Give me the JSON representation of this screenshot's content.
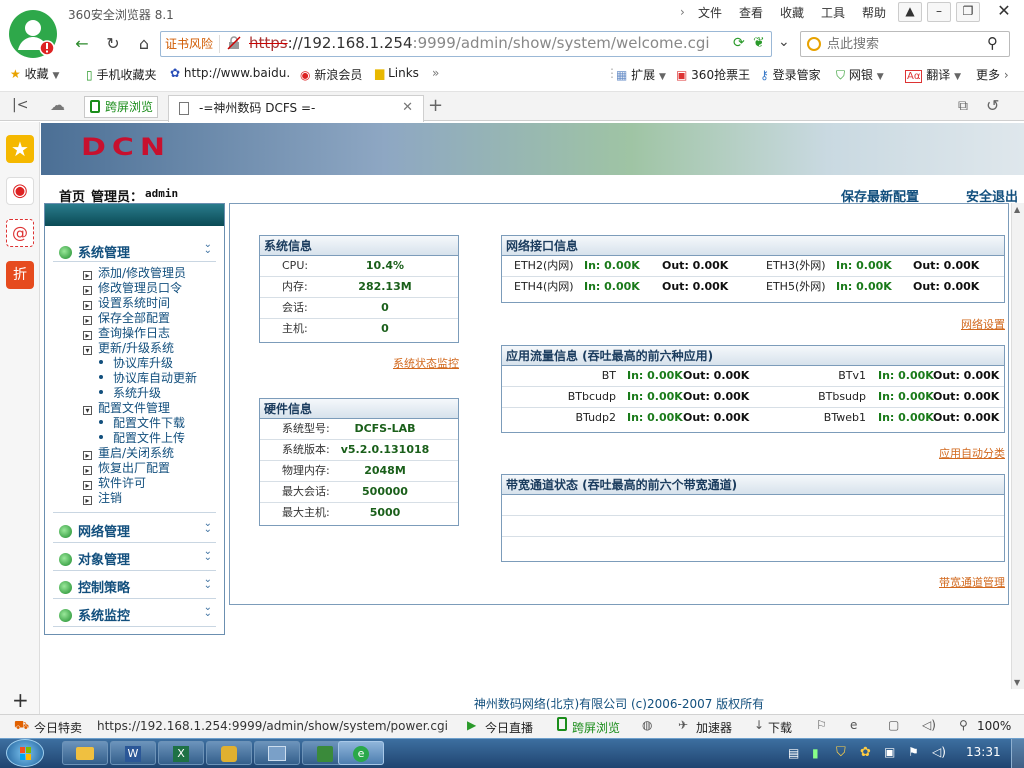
{
  "browser": {
    "app_title": "360安全浏览器 8.1",
    "menu": [
      "文件",
      "查看",
      "收藏",
      "工具",
      "帮助"
    ],
    "cert_risk": "证书风险",
    "url_protocol": "https",
    "url_sep": "://",
    "url_host": "192.168.1.254",
    "url_path": ":9999/admin/show/system/welcome.cgi",
    "search_placeholder": "点此搜索",
    "bookmarks": {
      "favorites": "收藏",
      "mobile": "手机收藏夹",
      "baidu": "http://www.baidu.",
      "sina": "新浪会员",
      "links": "Links",
      "extend": "扩展",
      "ticket": "360抢票王",
      "login_mgr": "登录管家",
      "bank": "网银",
      "translate": "翻译",
      "more": "更多"
    },
    "split_tab": "跨屏浏览",
    "tab_title": "-=神州数码 DCFS =-"
  },
  "page": {
    "logo": "DCN",
    "home": "首页",
    "admin_label": "管理员：",
    "admin_user": "admin",
    "save_config": "保存最新配置",
    "logout": "安全退出",
    "footer": "神州数码网络(北京)有限公司 (c)2006-2007 版权所有"
  },
  "nav": {
    "system_mgmt": "系统管理",
    "items": [
      {
        "label": "添加/修改管理员",
        "type": "box"
      },
      {
        "label": "修改管理员口令",
        "type": "box"
      },
      {
        "label": "设置系统时间",
        "type": "box"
      },
      {
        "label": "保存全部配置",
        "type": "box"
      },
      {
        "label": "查询操作日志",
        "type": "box"
      },
      {
        "label": "更新/升级系统",
        "type": "open"
      },
      {
        "label": "协议库升级",
        "type": "sub"
      },
      {
        "label": "协议库自动更新",
        "type": "sub"
      },
      {
        "label": "系统升级",
        "type": "sub"
      },
      {
        "label": "配置文件管理",
        "type": "open"
      },
      {
        "label": "配置文件下载",
        "type": "sub"
      },
      {
        "label": "配置文件上传",
        "type": "sub"
      },
      {
        "label": "重启/关闭系统",
        "type": "box"
      },
      {
        "label": "恢复出厂配置",
        "type": "box"
      },
      {
        "label": "软件许可",
        "type": "box"
      },
      {
        "label": "注销",
        "type": "box"
      }
    ],
    "network_mgmt": "网络管理",
    "object_mgmt": "对象管理",
    "control_policy": "控制策略",
    "system_monitor": "系统监控"
  },
  "sysinfo": {
    "title": "系统信息",
    "rows": [
      {
        "label": "CPU:",
        "value": "10.4%"
      },
      {
        "label": "内存:",
        "value": "282.13M"
      },
      {
        "label": "会话:",
        "value": "0"
      },
      {
        "label": "主机:",
        "value": "0"
      }
    ],
    "link": "系统状态监控"
  },
  "hwinfo": {
    "title": "硬件信息",
    "rows": [
      {
        "label": "系统型号:",
        "value": "DCFS-LAB"
      },
      {
        "label": "系统版本:",
        "value": "v5.2.0.131018"
      },
      {
        "label": "物理内存:",
        "value": "2048M"
      },
      {
        "label": "最大会话:",
        "value": "500000"
      },
      {
        "label": "最大主机:",
        "value": "5000"
      }
    ]
  },
  "netif": {
    "title": "网络接口信息",
    "rows": [
      [
        {
          "name": "ETH2(内网)",
          "in": "In: 0.00K",
          "out": "Out: 0.00K"
        },
        {
          "name": "ETH3(外网)",
          "in": "In: 0.00K",
          "out": "Out: 0.00K"
        }
      ],
      [
        {
          "name": "ETH4(内网)",
          "in": "In: 0.00K",
          "out": "Out: 0.00K"
        },
        {
          "name": "ETH5(外网)",
          "in": "In: 0.00K",
          "out": "Out: 0.00K"
        }
      ]
    ],
    "link": "网络设置"
  },
  "appflow": {
    "title": "应用流量信息 (吞吐最高的前六种应用)",
    "rows": [
      [
        {
          "name": "BT",
          "in": "In: 0.00K",
          "out": "Out: 0.00K"
        },
        {
          "name": "BTv1",
          "in": "In: 0.00K",
          "out": "Out: 0.00K"
        }
      ],
      [
        {
          "name": "BTbcudp",
          "in": "In: 0.00K",
          "out": "Out: 0.00K"
        },
        {
          "name": "BTbsudp",
          "in": "In: 0.00K",
          "out": "Out: 0.00K"
        }
      ],
      [
        {
          "name": "BTudp2",
          "in": "In: 0.00K",
          "out": "Out: 0.00K"
        },
        {
          "name": "BTweb1",
          "in": "In: 0.00K",
          "out": "Out: 0.00K"
        }
      ]
    ],
    "link": "应用自动分类"
  },
  "bandwidth": {
    "title": "带宽通道状态 (吞吐最高的前六个带宽通道)",
    "link": "带宽通道管理"
  },
  "status": {
    "today_deal": "今日特卖",
    "hover_url": "https://192.168.1.254:9999/admin/show/system/power.cgi",
    "live": "今日直播",
    "split": "跨屏浏览",
    "accelerator": "加速器",
    "download": "下载",
    "zoom": "100%"
  },
  "taskbar": {
    "time": "13:31"
  },
  "colors": {
    "accent": "#124f7d",
    "value_green": "#1a5f1a",
    "link_orange": "#d2691e"
  }
}
